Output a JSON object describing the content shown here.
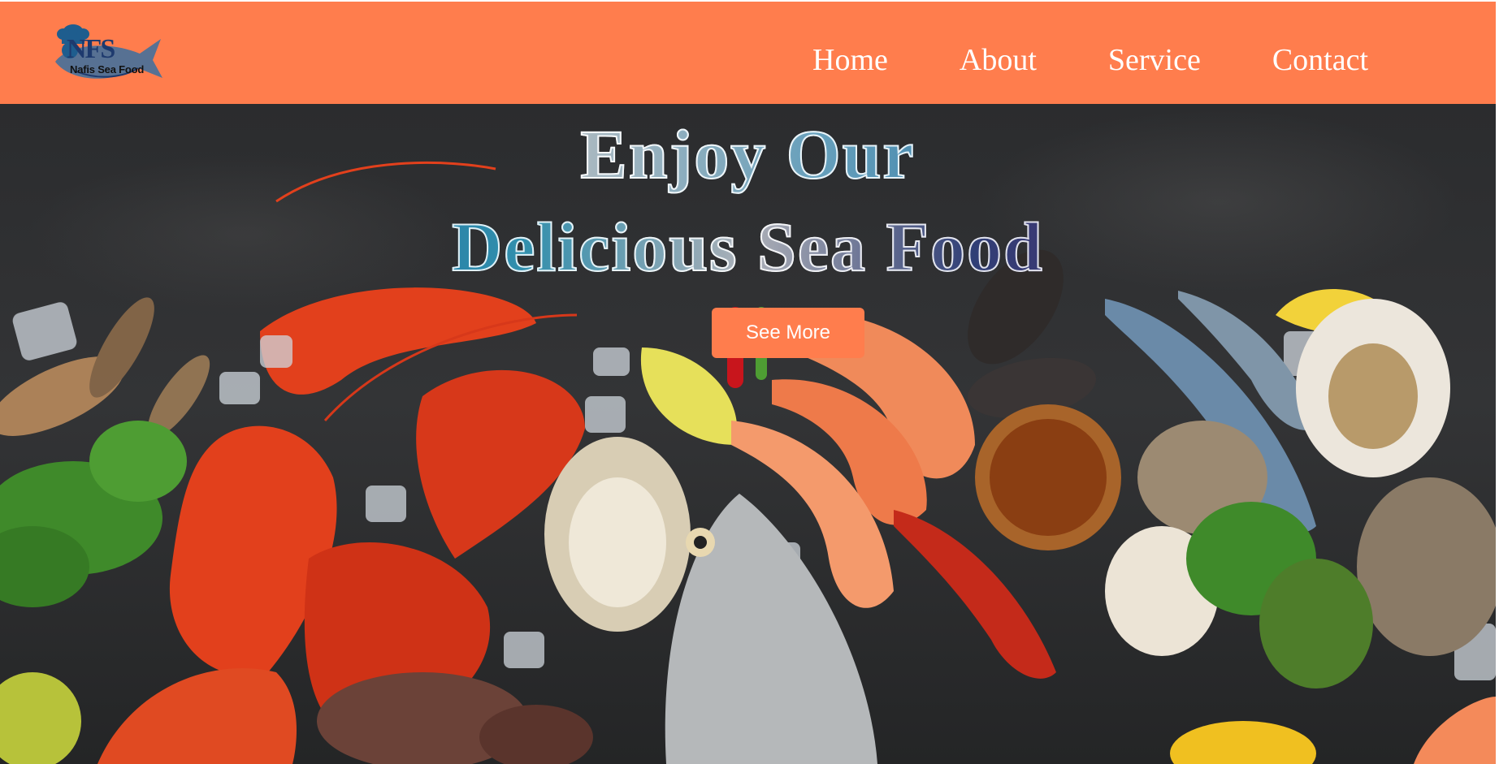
{
  "brand": {
    "logo_letters": "NFS",
    "logo_text": "Nafis Sea Food"
  },
  "nav": {
    "items": [
      {
        "label": "Home"
      },
      {
        "label": "About"
      },
      {
        "label": "Service"
      },
      {
        "label": "Contact"
      }
    ]
  },
  "hero": {
    "title_line1": "Enjoy Our",
    "title_line2": "Delicious Sea Food",
    "cta_label": "See More"
  },
  "colors": {
    "accent": "#ff7d4d",
    "hero_background": "#2b2c2e",
    "nav_text": "#ffffff"
  },
  "icons": {
    "logo": "chef-fish-logo-icon"
  }
}
